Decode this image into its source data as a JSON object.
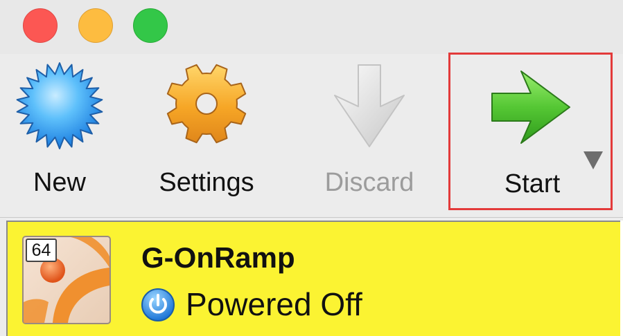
{
  "window": {
    "controls": {
      "close_color": "#fc5753",
      "minimize_color": "#fdbc40",
      "zoom_color": "#33c748"
    }
  },
  "toolbar": {
    "new": {
      "label": "New",
      "icon": "starburst-icon",
      "color": "#3ba5f5"
    },
    "settings": {
      "label": "Settings",
      "icon": "gear-icon",
      "color": "#f4a321"
    },
    "discard": {
      "label": "Discard",
      "icon": "down-arrow-icon",
      "disabled": true
    },
    "start": {
      "label": "Start",
      "icon": "right-arrow-icon",
      "color": "#4cc22b",
      "highlight_color": "#e33a3a",
      "dropdown_icon": "triangle-down-icon"
    }
  },
  "vm_list": {
    "items": [
      {
        "name": "G-OnRamp",
        "state": "Powered Off",
        "bits": "64",
        "state_icon": "power-icon",
        "selected": true,
        "selection_color": "#fbf332"
      }
    ]
  }
}
